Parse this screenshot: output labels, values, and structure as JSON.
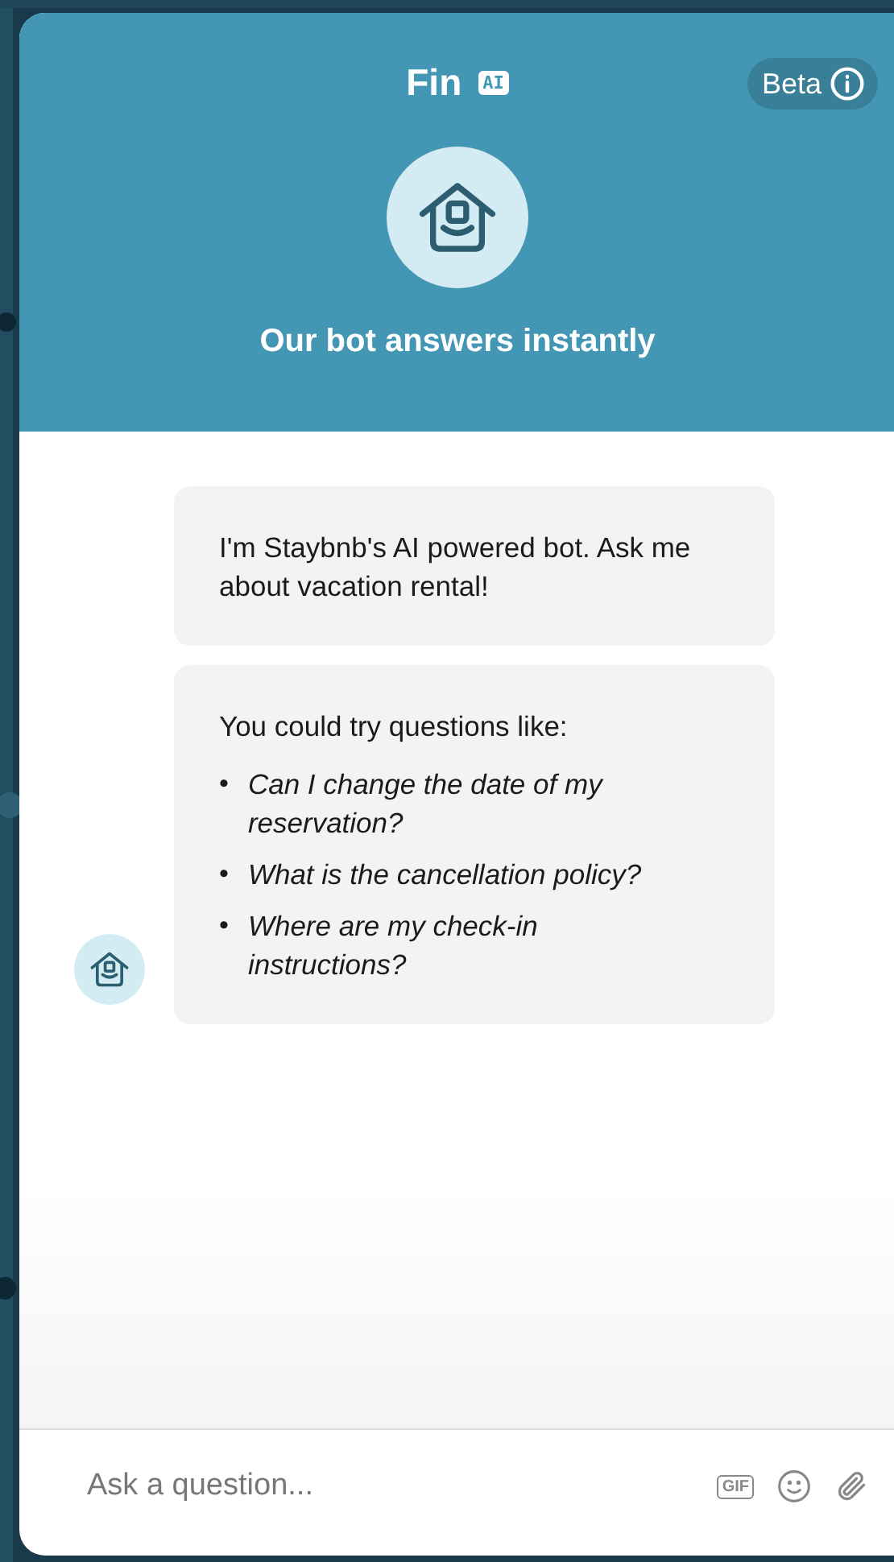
{
  "header": {
    "title": "Fin",
    "badge": "AI",
    "beta": "Beta",
    "subtitle": "Our bot answers instantly"
  },
  "messages": [
    {
      "kind": "text",
      "text": "I'm Staybnb's AI powered bot. Ask me about vacation rental!",
      "avatar": false
    },
    {
      "kind": "list",
      "text": "You could try questions like:",
      "bullet": "•",
      "items": [
        "Can I change the date of my reservation?",
        "What is the cancellation policy?",
        "Where are my check-in instructions?"
      ],
      "avatar": true
    }
  ],
  "composer": {
    "placeholder": "Ask a question...",
    "gif": "GIF"
  }
}
